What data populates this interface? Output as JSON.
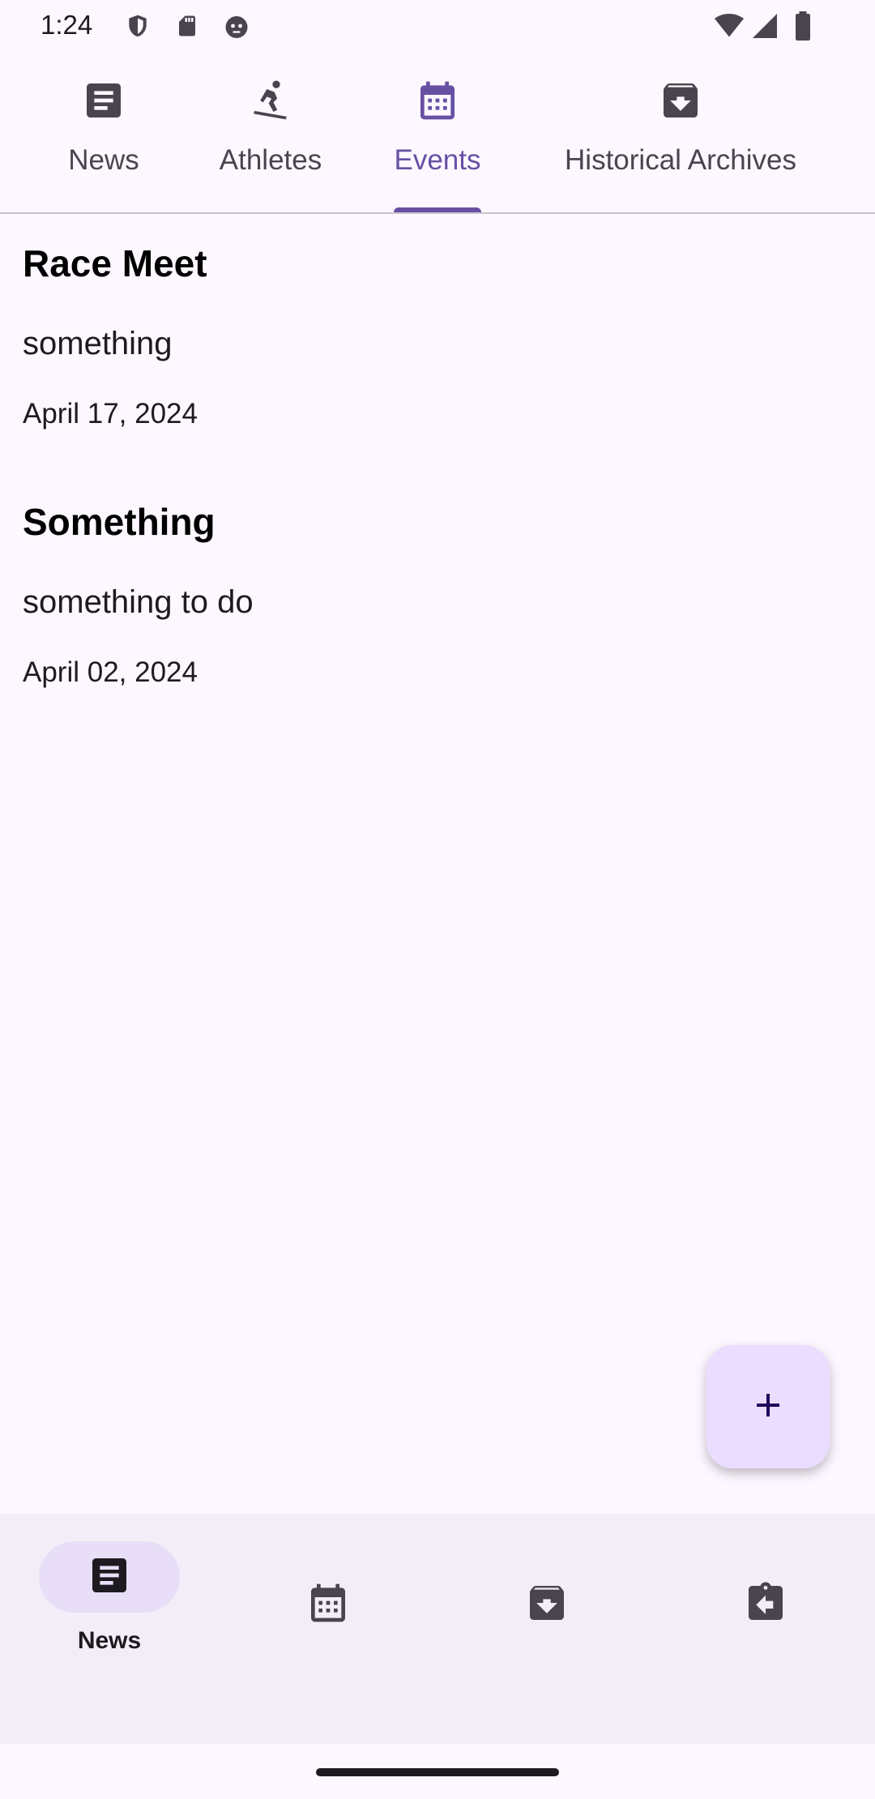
{
  "status_bar": {
    "time": "1:24",
    "left_icons": [
      "shield-icon",
      "sd-card-icon",
      "cat-face-icon"
    ],
    "right_icons": [
      "wifi-icon",
      "signal-icon",
      "battery-icon"
    ]
  },
  "tabs": [
    {
      "label": "News",
      "icon": "article-icon",
      "active": false
    },
    {
      "label": "Athletes",
      "icon": "skier-icon",
      "active": false
    },
    {
      "label": "Events",
      "icon": "calendar-icon",
      "active": true
    },
    {
      "label": "Historical Archives",
      "icon": "archive-icon",
      "active": false
    }
  ],
  "events": [
    {
      "title": "Race Meet",
      "description": "something",
      "date": "April 17, 2024"
    },
    {
      "title": "Something",
      "description": "something to do",
      "date": "April 02, 2024"
    }
  ],
  "fab": {
    "icon": "plus-icon"
  },
  "bottom_nav": {
    "items": [
      {
        "label": "News",
        "icon": "article-icon",
        "active": true
      },
      {
        "label": "",
        "icon": "calendar-icon",
        "active": false
      },
      {
        "label": "",
        "icon": "archive-icon",
        "active": false
      },
      {
        "label": "",
        "icon": "assignment-return-icon",
        "active": false
      }
    ]
  },
  "colors": {
    "background": "#fdf7ff",
    "accent": "#6750a4",
    "fab_background": "#eaddff",
    "nav_background": "#f3edf7",
    "nav_active_pill": "#e8def8"
  }
}
